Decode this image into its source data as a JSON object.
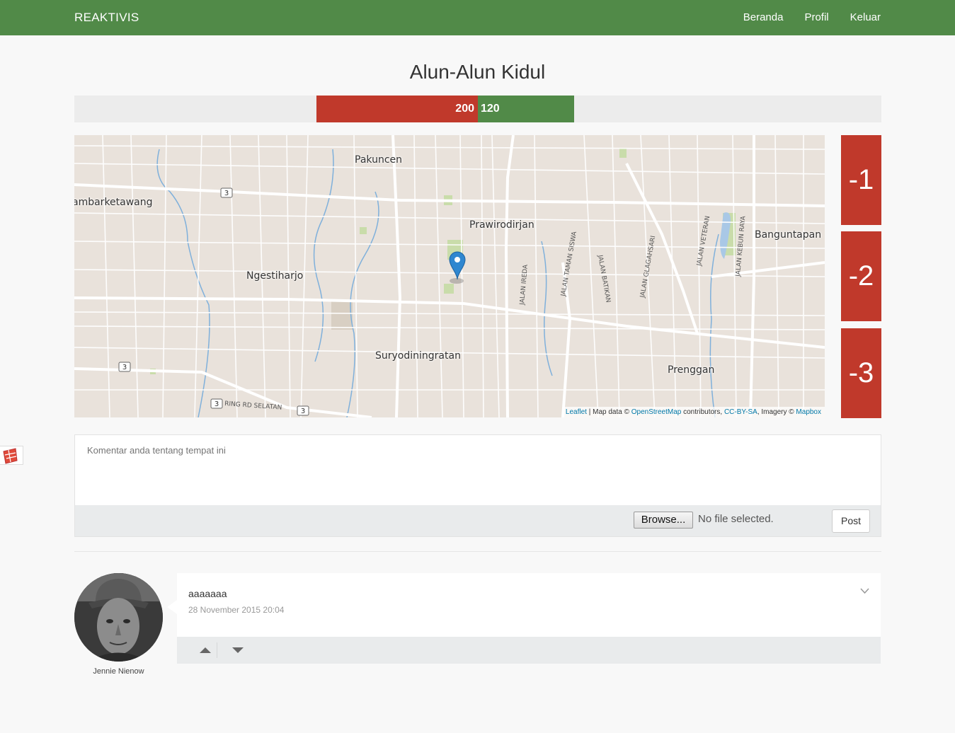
{
  "nav": {
    "brand": "REAKTIVIS",
    "links": [
      "Beranda",
      "Profil",
      "Keluar"
    ]
  },
  "place": {
    "title": "Alun-Alun Kidul"
  },
  "votes": {
    "negative": "200",
    "positive": "120",
    "negative_color": "#c0392b",
    "positive_color": "#518a48"
  },
  "map": {
    "labels": [
      "Pakuncen",
      "ambarketawang",
      "Prawirodirjan",
      "Banguntapan",
      "Ngestiharjo",
      "Suryodiningratan",
      "Prenggan"
    ],
    "road_labels": [
      "JALAN TAMAN SISWA",
      "JALAN BATIKAN",
      "JALAN GLAGAHSARI",
      "JALAN VETERAN",
      "JALAN KEBUN RAYA",
      "JALAN IREDA",
      "RING RD SELATAN"
    ],
    "shields": [
      "3",
      "3",
      "3",
      "3"
    ],
    "attribution": {
      "leaflet": "Leaflet",
      "text1": " | Map data © ",
      "osm": "OpenStreetMap",
      "text2": " contributors, ",
      "license": "CC-BY-SA",
      "text3": ", Imagery © ",
      "mapbox": "Mapbox"
    }
  },
  "rating_buttons": [
    "-1",
    "-2",
    "-3"
  ],
  "comment_form": {
    "placeholder": "Komentar anda tentang tempat ini",
    "browse_label": "Browse...",
    "no_file": "No file selected.",
    "post_label": "Post"
  },
  "posts": [
    {
      "author": "Jennie Nienow",
      "text": "aaaaaaa",
      "time": "28 November 2015 20:04"
    }
  ]
}
